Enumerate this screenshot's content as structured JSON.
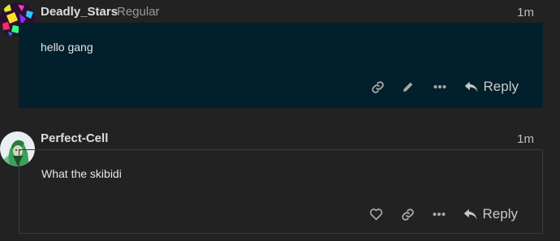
{
  "posts": [
    {
      "username": "Deadly_Stars",
      "user_title": "Regular",
      "time": "1m",
      "text": "hello gang",
      "highlighted": true,
      "actions": [
        "link-icon",
        "edit-icon",
        "more-icon"
      ],
      "reply_label": "Reply"
    },
    {
      "username": "Perfect-Cell",
      "user_title": "",
      "time": "1m",
      "text": "What the skibidi",
      "highlighted": false,
      "actions": [
        "heart-icon",
        "link-icon",
        "more-icon"
      ],
      "reply_label": "Reply"
    }
  ],
  "colors": {
    "background": "#222222",
    "highlight_bg": "#02202b",
    "text": "#dddddd",
    "muted": "#9a9a9a",
    "icon": "#a8a8a8"
  }
}
